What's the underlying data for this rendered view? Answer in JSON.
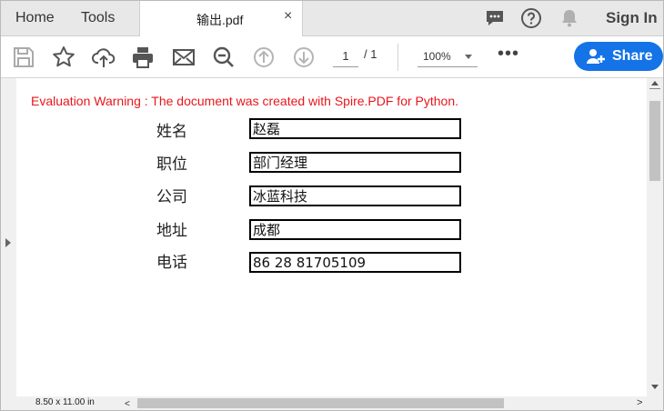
{
  "tabs": {
    "home": "Home",
    "tools": "Tools",
    "document": "输出.pdf",
    "close": "×"
  },
  "header": {
    "icons": [
      "comment-icon",
      "help-icon",
      "bell-icon"
    ],
    "sign_in": "Sign In"
  },
  "toolbar": {
    "icons": [
      "save-icon",
      "star-icon",
      "upload-icon",
      "print-icon",
      "email-icon",
      "zoom-search-icon",
      "page-up-icon",
      "page-down-icon"
    ],
    "page_current": "1",
    "page_total": "/ 1",
    "zoom": "100%",
    "more": "•••",
    "share": "Share",
    "accent": "#1473e6"
  },
  "document": {
    "warning": "Evaluation Warning : The document was created with Spire.PDF for Python.",
    "warning_color": "#e8161c",
    "fields": [
      {
        "label": "姓名",
        "value": "赵磊"
      },
      {
        "label": "职位",
        "value": "部门经理"
      },
      {
        "label": "公司",
        "value": "冰蓝科技"
      },
      {
        "label": "地址",
        "value": "成都"
      },
      {
        "label": "电话",
        "value": "86 28 81705109"
      }
    ]
  },
  "status": {
    "page_size": "8.50 x 11.00 in"
  }
}
